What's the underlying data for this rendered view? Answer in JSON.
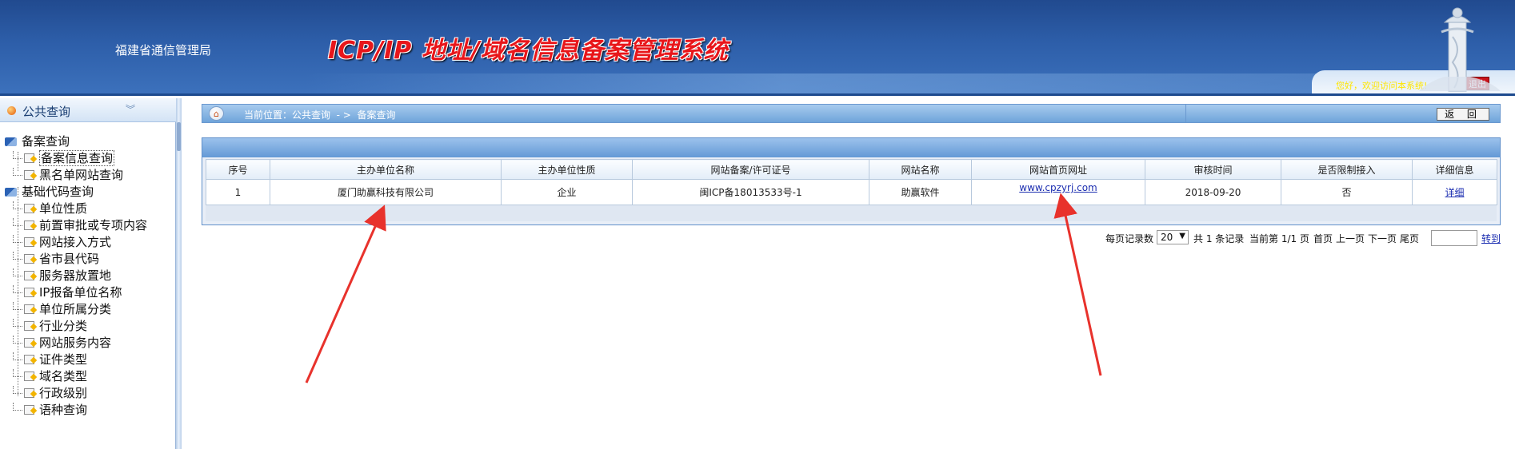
{
  "header": {
    "org_name": "福建省通信管理局",
    "system_title": "ICP/IP 地址/域名信息备案管理系统",
    "welcome_text": "您好，欢迎访问本系统!",
    "logout_label": "退出"
  },
  "sidebar": {
    "title": "公共查询",
    "groups": [
      {
        "label": "备案查询",
        "items": [
          "备案信息查询",
          "黑名单网站查询"
        ]
      },
      {
        "label": "基础代码查询",
        "items": [
          "单位性质",
          "前置审批或专项内容",
          "网站接入方式",
          "省市县代码",
          "服务器放置地",
          "IP报备单位名称",
          "单位所属分类",
          "行业分类",
          "网站服务内容",
          "证件类型",
          "域名类型",
          "行政级别",
          "语种查询"
        ]
      }
    ]
  },
  "breadcrumb": {
    "text": "当前位置：公共查询  - >  备案查询"
  },
  "back_button": "返  回",
  "table": {
    "columns": [
      "序号",
      "主办单位名称",
      "主办单位性质",
      "网站备案/许可证号",
      "网站名称",
      "网站首页网址",
      "审核时间",
      "是否限制接入",
      "详细信息"
    ],
    "rows": [
      {
        "index": "1",
        "org": "厦门助赢科技有限公司",
        "org_type": "企业",
        "license": "闽ICP备18013533号-1",
        "site_name": "助赢软件",
        "url": "www.cpzyrj.com",
        "review_time": "2018-09-20",
        "restricted": "否",
        "detail": "详细"
      }
    ]
  },
  "pager": {
    "per_page_label": "每页记录数",
    "page_size": "20",
    "total": "共 1 条记录",
    "current": "当前第 1/1 页",
    "first": "首页",
    "prev": "上一页",
    "next": "下一页",
    "last": "尾页",
    "jump": "转到"
  },
  "colors": {
    "header_blue": "#2d5ea9",
    "title_red": "#e8161a",
    "annotation_red": "#e8322c",
    "link_blue": "#1d2fb1"
  },
  "icons": [
    "home-icon",
    "collapse-chevrons-icon",
    "folder-group-icon",
    "tree-node-icon",
    "pillar-logo-icon",
    "dropdown-arrow-icon"
  ]
}
